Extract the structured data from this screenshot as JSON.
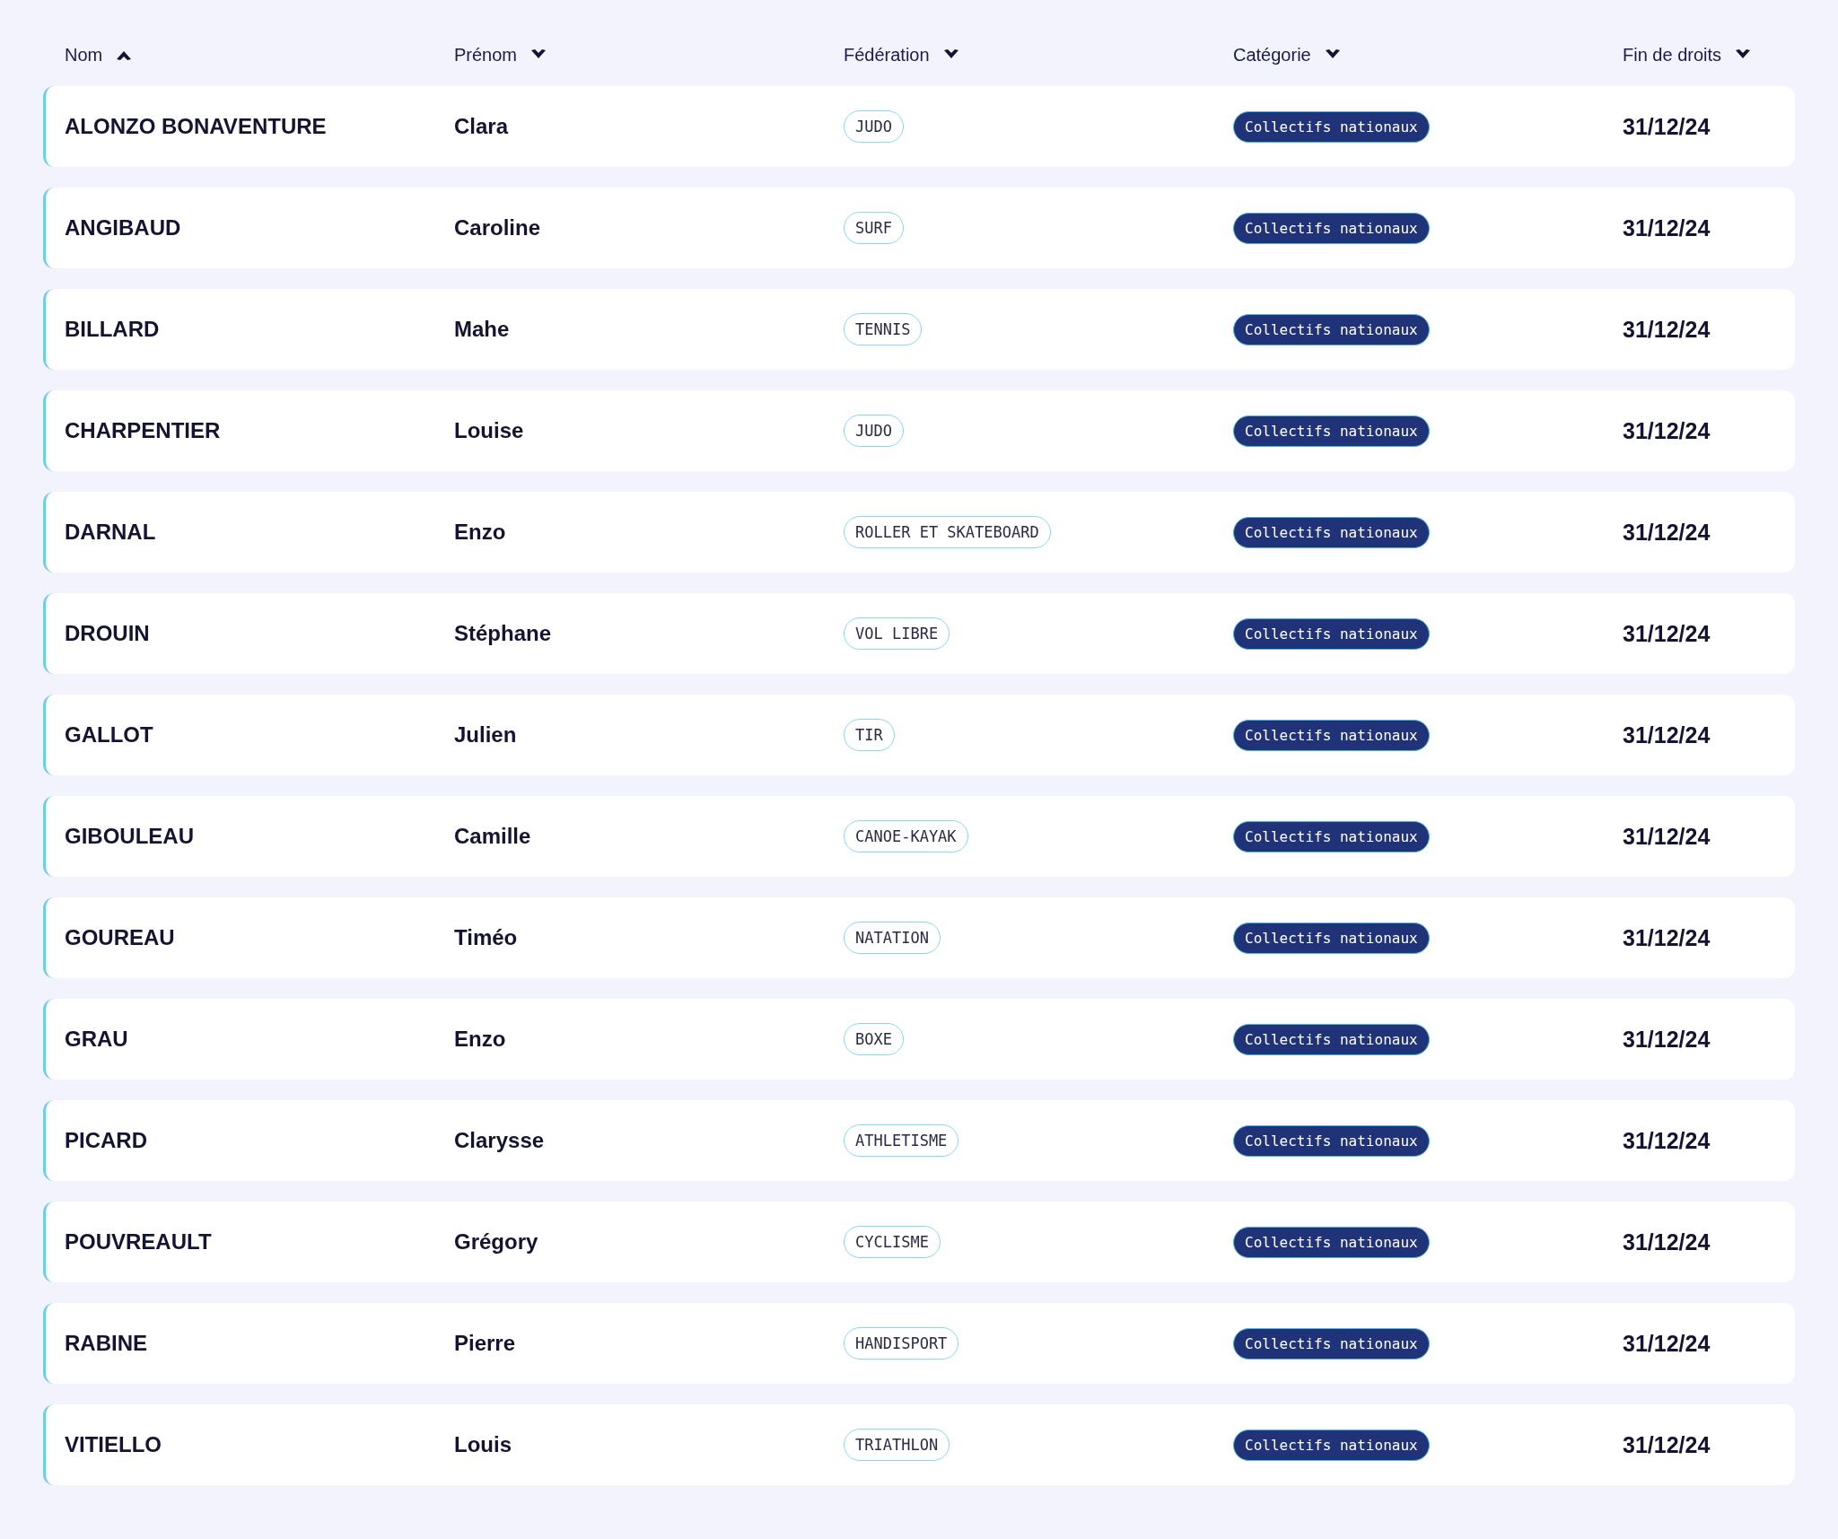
{
  "columns": [
    {
      "label": "Nom",
      "ascending": true
    },
    {
      "label": "Prénom",
      "ascending": false
    },
    {
      "label": "Fédération",
      "ascending": false
    },
    {
      "label": "Catégorie",
      "ascending": false
    },
    {
      "label": "Fin de droits",
      "ascending": false
    }
  ],
  "rows": [
    {
      "nom": "ALONZO BONAVENTURE",
      "prenom": "Clara",
      "federation": "JUDO",
      "categorie": "Collectifs nationaux",
      "fin": "31/12/24"
    },
    {
      "nom": "ANGIBAUD",
      "prenom": "Caroline",
      "federation": "SURF",
      "categorie": "Collectifs nationaux",
      "fin": "31/12/24"
    },
    {
      "nom": "BILLARD",
      "prenom": "Mahe",
      "federation": "TENNIS",
      "categorie": "Collectifs nationaux",
      "fin": "31/12/24"
    },
    {
      "nom": "CHARPENTIER",
      "prenom": "Louise",
      "federation": "JUDO",
      "categorie": "Collectifs nationaux",
      "fin": "31/12/24"
    },
    {
      "nom": "DARNAL",
      "prenom": "Enzo",
      "federation": "ROLLER ET SKATEBOARD",
      "categorie": "Collectifs nationaux",
      "fin": "31/12/24"
    },
    {
      "nom": "DROUIN",
      "prenom": "Stéphane",
      "federation": "VOL LIBRE",
      "categorie": "Collectifs nationaux",
      "fin": "31/12/24"
    },
    {
      "nom": "GALLOT",
      "prenom": "Julien",
      "federation": "TIR",
      "categorie": "Collectifs nationaux",
      "fin": "31/12/24"
    },
    {
      "nom": "GIBOULEAU",
      "prenom": "Camille",
      "federation": "CANOE-KAYAK",
      "categorie": "Collectifs nationaux",
      "fin": "31/12/24"
    },
    {
      "nom": "GOUREAU",
      "prenom": "Timéo",
      "federation": "NATATION",
      "categorie": "Collectifs nationaux",
      "fin": "31/12/24"
    },
    {
      "nom": "GRAU",
      "prenom": "Enzo",
      "federation": "BOXE",
      "categorie": "Collectifs nationaux",
      "fin": "31/12/24"
    },
    {
      "nom": "PICARD",
      "prenom": "Clarysse",
      "federation": "ATHLETISME",
      "categorie": "Collectifs nationaux",
      "fin": "31/12/24"
    },
    {
      "nom": "POUVREAULT",
      "prenom": "Grégory",
      "federation": "CYCLISME",
      "categorie": "Collectifs nationaux",
      "fin": "31/12/24"
    },
    {
      "nom": "RABINE",
      "prenom": "Pierre",
      "federation": "HANDISPORT",
      "categorie": "Collectifs nationaux",
      "fin": "31/12/24"
    },
    {
      "nom": "VITIELLO",
      "prenom": "Louis",
      "federation": "TRIATHLON",
      "categorie": "Collectifs nationaux",
      "fin": "31/12/24"
    }
  ]
}
